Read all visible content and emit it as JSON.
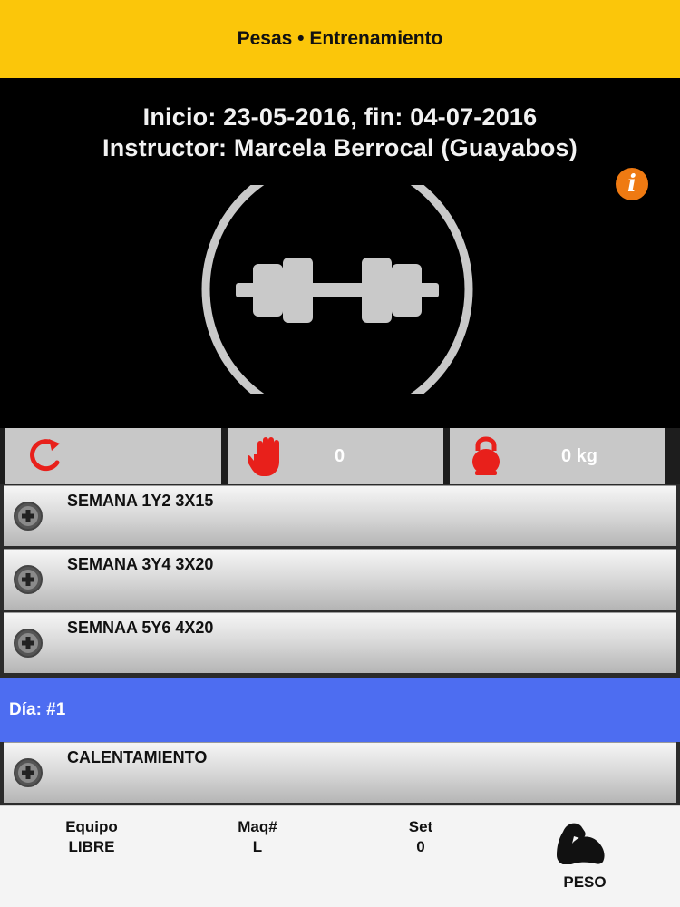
{
  "header": {
    "title": "Pesas • Entrenamiento"
  },
  "hero": {
    "dates": "Inicio: 23-05-2016, fin: 04-07-2016",
    "instructor": "Instructor: Marcela Berrocal (Guayabos)",
    "info_icon": "info-icon",
    "emblem_icon": "dumbbell-icon"
  },
  "stats": {
    "repeat_icon": "repeat-icon",
    "hand_icon": "hand-icon",
    "hand_value": "0",
    "kettlebell_icon": "kettlebell-icon",
    "weight_value": "0 kg"
  },
  "weeks": [
    {
      "label": "SEMANA 1Y2 3X15"
    },
    {
      "label": "SEMANA 3Y4 3X20"
    },
    {
      "label": "SEMNAA 5Y6 4X20"
    }
  ],
  "day": {
    "label": "Día: #1"
  },
  "exercise": {
    "label": "CALENTAMIENTO"
  },
  "footer": {
    "equipo_label": "Equipo",
    "equipo_value": "LIBRE",
    "maq_label": "Maq#",
    "maq_value": "L",
    "set_label": "Set",
    "set_value": "0",
    "peso_label": "PESO",
    "peso_icon": "flexed-bicep-icon"
  },
  "colors": {
    "header": "#fbc60a",
    "accent_red": "#e8201b",
    "info_orange": "#ef7a12",
    "day_bar": "#4d6df1"
  }
}
